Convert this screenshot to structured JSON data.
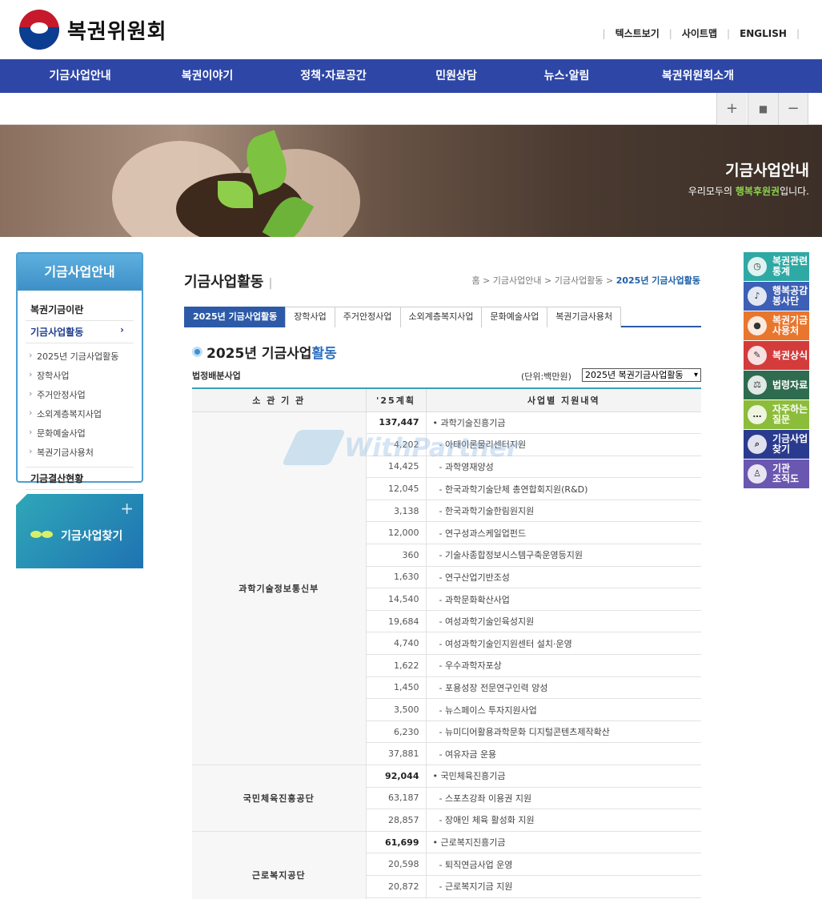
{
  "header": {
    "logo_text": "복권위원회",
    "util": [
      "텍스트보기",
      "사이트맵",
      "ENGLISH"
    ]
  },
  "gnb": [
    "기금사업안내",
    "복권이야기",
    "정책·자료공간",
    "민원상담",
    "뉴스·알림",
    "복권위원회소개"
  ],
  "fontbar": {
    "plus": "+",
    "reset": "■",
    "minus": "−"
  },
  "hero": {
    "title": "기금사업안내",
    "sub_pre": "우리모두의 ",
    "sub_hl": "행복후원권",
    "sub_post": "입니다."
  },
  "lnb": {
    "title": "기금사업안내",
    "items": [
      "복권기금이란",
      "기금사업활동",
      "기금결산현황"
    ],
    "active_arrow": "›",
    "subitems": [
      "2025년 기금사업활동",
      "장학사업",
      "주거안정사업",
      "소외계층복지사업",
      "문화예술사업",
      "복권기금사용처"
    ]
  },
  "find_box": {
    "label": "기금사업찾기",
    "plus": "+"
  },
  "quick": [
    {
      "l1": "복권관련",
      "l2": "통계",
      "color": "#2fa9a4",
      "icon": "clock-icon",
      "glyph": "◷"
    },
    {
      "l1": "행복공감",
      "l2": "봉사단",
      "color": "#3d5fb6",
      "icon": "music-icon",
      "glyph": "♪"
    },
    {
      "l1": "복권기금",
      "l2": "사용처",
      "color": "#e9762d",
      "icon": "piggy-icon",
      "glyph": "●"
    },
    {
      "l1": "복권상식",
      "l2": "",
      "color": "#d43b3b",
      "icon": "pencil-icon",
      "glyph": "✎"
    },
    {
      "l1": "법령자료",
      "l2": "",
      "color": "#2f6b4f",
      "icon": "gavel-icon",
      "glyph": "⚖"
    },
    {
      "l1": "자주하는",
      "l2": "질문",
      "color": "#8cbd3a",
      "icon": "chat-icon",
      "glyph": "…"
    },
    {
      "l1": "기금사업",
      "l2": "찾기",
      "color": "#2a3b8f",
      "icon": "search-icon",
      "glyph": "⌕"
    },
    {
      "l1": "기관",
      "l2": "조직도",
      "color": "#6a57b0",
      "icon": "org-icon",
      "glyph": "♙"
    }
  ],
  "content": {
    "title": "기금사업활동",
    "title_bar": "|",
    "breadcrumb": [
      "홈",
      "기금사업안내",
      "기금사업활동",
      "2025년 기금사업활동"
    ],
    "tabs": [
      "2025년 기금사업활동",
      "장학사업",
      "주거안정사업",
      "소외계층복지사업",
      "문화예술사업",
      "복권기금사용처"
    ],
    "section_title_pre": "2025년 기금사업",
    "section_title_hl": "활동",
    "subhead": "법정배분사업",
    "unit": "(단위:백만원)",
    "select_value": "2025년 복권기금사업활동",
    "table_headers": [
      "소 관 기 관",
      "'25계획",
      "사업별 지원내역"
    ],
    "groups": [
      {
        "org": "과학기술정보통신부",
        "rows": [
          {
            "amt": "137,447",
            "desc": "• 과학기술진흥기금",
            "total": true
          },
          {
            "amt": "4,202",
            "desc": "- 아태이론물리센터지원"
          },
          {
            "amt": "14,425",
            "desc": "- 과학영재양성"
          },
          {
            "amt": "12,045",
            "desc": "- 한국과학기술단체 총연합회지원(R&D)"
          },
          {
            "amt": "3,138",
            "desc": "- 한국과학기술한림원지원"
          },
          {
            "amt": "12,000",
            "desc": "- 연구성과스케일업펀드"
          },
          {
            "amt": "360",
            "desc": "- 기술사종합정보시스템구축운영등지원"
          },
          {
            "amt": "1,630",
            "desc": "- 연구산업기반조성"
          },
          {
            "amt": "14,540",
            "desc": "- 과학문화확산사업"
          },
          {
            "amt": "19,684",
            "desc": "- 여성과학기술인육성지원"
          },
          {
            "amt": "4,740",
            "desc": "- 여성과학기술인지원센터 설치·운영"
          },
          {
            "amt": "1,622",
            "desc": "- 우수과학자포상"
          },
          {
            "amt": "1,450",
            "desc": "- 포용성장 전문연구인력 양성"
          },
          {
            "amt": "3,500",
            "desc": "- 뉴스페이스 투자지원사업"
          },
          {
            "amt": "6,230",
            "desc": "- 뉴미디어활용과학문화 디지털콘텐츠제작확산"
          },
          {
            "amt": "37,881",
            "desc": "- 여유자금 운용"
          }
        ]
      },
      {
        "org": "국민체육진흥공단",
        "rows": [
          {
            "amt": "92,044",
            "desc": "• 국민체육진흥기금",
            "total": true
          },
          {
            "amt": "63,187",
            "desc": "- 스포츠강좌 이용권 지원"
          },
          {
            "amt": "28,857",
            "desc": "- 장애인 체육 활성화 지원"
          }
        ]
      },
      {
        "org": "근로복지공단",
        "rows": [
          {
            "amt": "61,699",
            "desc": "• 근로복지진흥기금",
            "total": true
          },
          {
            "amt": "20,598",
            "desc": "- 퇴직연금사업 운영"
          },
          {
            "amt": "20,872",
            "desc": "- 근로복지기금 지원"
          },
          {
            "amt": "",
            "desc": ""
          }
        ]
      }
    ]
  },
  "watermark": {
    "pre": "With",
    "post": "Partner"
  }
}
